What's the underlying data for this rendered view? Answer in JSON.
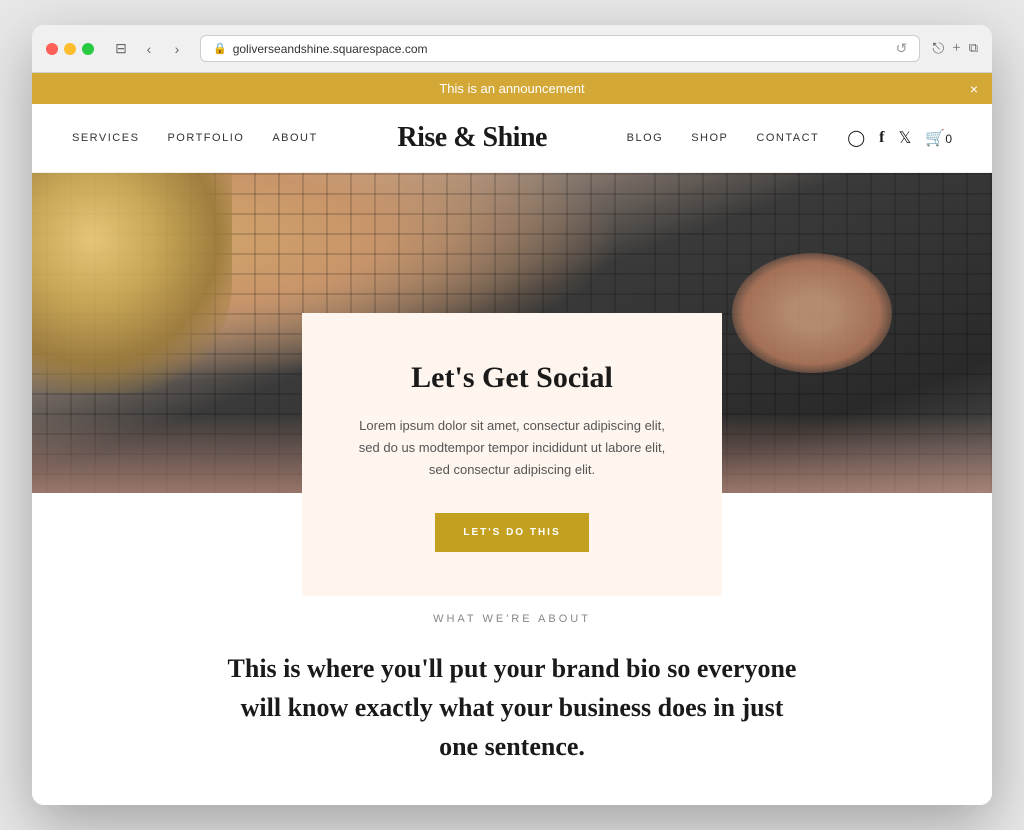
{
  "browser": {
    "url": "goliverseandshine.squarespace.com",
    "back_label": "‹",
    "forward_label": "›",
    "reload_label": "↺",
    "share_label": "⎋",
    "new_tab_label": "+",
    "duplicate_label": "⧉"
  },
  "announcement": {
    "text": "This is an announcement",
    "close_label": "×"
  },
  "nav": {
    "left_links": [
      {
        "label": "SERVICES"
      },
      {
        "label": "PORTFOLIO"
      },
      {
        "label": "ABOUT"
      }
    ],
    "logo": "Rise & Shine",
    "right_links": [
      {
        "label": "BLOG"
      },
      {
        "label": "SHOP"
      },
      {
        "label": "CONTACT"
      }
    ],
    "cart_count": "0"
  },
  "social_card": {
    "title": "Let's Get Social",
    "body": "Lorem ipsum dolor sit amet, consectur adipiscing elit, sed do us modtempor tempor incididunt ut labore elit, sed consectur adipiscing elit.",
    "button_label": "LET'S DO THIS"
  },
  "about": {
    "label": "WHAT WE'RE ABOUT",
    "headline": "This is where you'll put your brand bio so everyone will know exactly what your business does in just one sentence."
  }
}
